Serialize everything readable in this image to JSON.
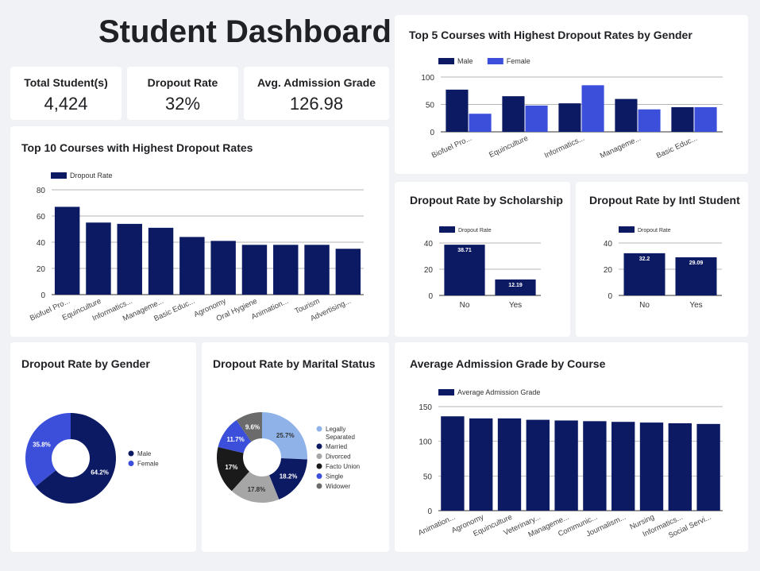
{
  "header": {
    "title": "Student Dashboard"
  },
  "kpis": [
    {
      "label": "Total Student(s)",
      "value": "4,424"
    },
    {
      "label": "Dropout Rate",
      "value": "32%"
    },
    {
      "label": "Avg. Admission Grade",
      "value": "126.98"
    }
  ],
  "colors": {
    "navy": "#0c1a63",
    "blue": "#3b4fdb",
    "grid": "#9e9e9e",
    "axis": "#555555",
    "light_blue": "#8fb3e8",
    "gray": "#a6a6a6",
    "dark": "#1a1a1a",
    "dark_gray": "#6b6b6b"
  },
  "chart_data": [
    {
      "id": "top5_gender",
      "type": "bar",
      "title": "Top 5 Courses with Highest Dropout Rates by Gender",
      "categories": [
        "Biofuel Pro...",
        "Equinculture",
        "Informatics...",
        "Manageme...",
        "Basic Educ..."
      ],
      "series": [
        {
          "name": "Male",
          "color": "#0c1a63",
          "values": [
            77,
            65,
            52,
            60,
            45
          ]
        },
        {
          "name": "Female",
          "color": "#3b4fdb",
          "values": [
            33,
            48,
            85,
            41,
            45
          ]
        }
      ],
      "yticks": [
        "0",
        "50",
        "100"
      ],
      "ylim": [
        0,
        100
      ],
      "legend": "top-left"
    },
    {
      "id": "top10",
      "type": "bar",
      "title": "Top 10 Courses with Highest Dropout Rates",
      "categories": [
        "Biofuel Pro...",
        "Equinculture",
        "Informatics...",
        "Manageme...",
        "Basic Educ...",
        "Agronomy",
        "Oral Hygiene",
        "Animation...",
        "Tourism",
        "Advertising..."
      ],
      "series": [
        {
          "name": "Dropout Rate",
          "color": "#0c1a63",
          "values": [
            67,
            55,
            54,
            51,
            44,
            41,
            38,
            38,
            38,
            35
          ]
        }
      ],
      "yticks": [
        "0",
        "20",
        "40",
        "60",
        "80"
      ],
      "ylim": [
        0,
        80
      ],
      "legend": "top-left"
    },
    {
      "id": "scholarship",
      "type": "bar",
      "title": "Dropout Rate by Scholarship",
      "categories": [
        "No",
        "Yes"
      ],
      "series": [
        {
          "name": "Dropout Rate",
          "color": "#0c1a63",
          "values": [
            38.71,
            12.19
          ]
        }
      ],
      "labels": [
        "38.71",
        "12.19"
      ],
      "yticks": [
        "0",
        "20",
        "40"
      ],
      "ylim": [
        0,
        40
      ],
      "legend": "top-left"
    },
    {
      "id": "intl",
      "type": "bar",
      "title": "Dropout Rate by Intl Student",
      "categories": [
        "No",
        "Yes"
      ],
      "series": [
        {
          "name": "Dropout Rate",
          "color": "#0c1a63",
          "values": [
            32.2,
            29.09
          ]
        }
      ],
      "labels": [
        "32.2",
        "29.09"
      ],
      "yticks": [
        "0",
        "20",
        "40"
      ],
      "ylim": [
        0,
        40
      ],
      "legend": "top-left"
    },
    {
      "id": "gender",
      "type": "pie",
      "title": "Dropout Rate by Gender",
      "slices": [
        {
          "name": "Male",
          "value": 64.2,
          "label": "64.2%",
          "color": "#0c1a63"
        },
        {
          "name": "Female",
          "value": 35.8,
          "label": "35.8%",
          "color": "#3b4fdb"
        }
      ],
      "legend": "right"
    },
    {
      "id": "marital",
      "type": "pie",
      "title": "Dropout Rate by Marital Status",
      "slices": [
        {
          "name": "Legally Separated",
          "value": 25.7,
          "label": "25.7%",
          "color": "#8fb3e8"
        },
        {
          "name": "Married",
          "value": 18.2,
          "label": "18.2%",
          "color": "#0c1a63"
        },
        {
          "name": "Divorced",
          "value": 17.8,
          "label": "17.8%",
          "color": "#a6a6a6"
        },
        {
          "name": "Facto Union",
          "value": 17.0,
          "label": "17%",
          "color": "#1a1a1a"
        },
        {
          "name": "Single",
          "value": 11.7,
          "label": "11.7%",
          "color": "#3b4fdb"
        },
        {
          "name": "Widower",
          "value": 9.6,
          "label": "9.6%",
          "color": "#6b6b6b"
        }
      ],
      "legend": "right"
    },
    {
      "id": "admission",
      "type": "bar",
      "title": "Average Admission Grade by Course",
      "categories": [
        "Animation...",
        "Agronomy",
        "Equinculture",
        "Veterinary...",
        "Manageme...",
        "Communic...",
        "Journalism...",
        "Nursing",
        "Informatics...",
        "Social Servi..."
      ],
      "series": [
        {
          "name": "Average Admission Grade",
          "color": "#0c1a63",
          "values": [
            136,
            133,
            133,
            131,
            130,
            129,
            128,
            127,
            126,
            125
          ]
        }
      ],
      "yticks": [
        "0",
        "50",
        "100",
        "150"
      ],
      "ylim": [
        0,
        150
      ],
      "legend": "top-left"
    }
  ]
}
